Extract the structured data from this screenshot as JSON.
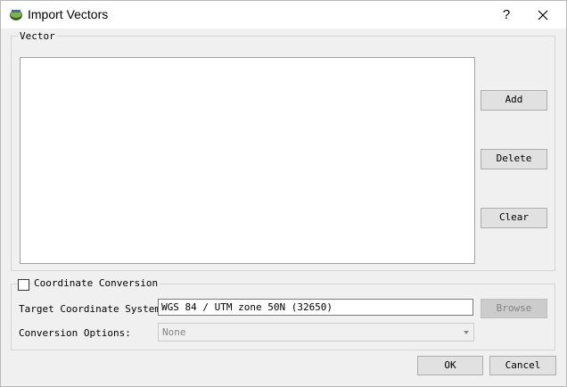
{
  "window": {
    "title": "Import Vectors",
    "help_label": "?"
  },
  "vector_group": {
    "legend": "Vector",
    "buttons": {
      "add": "Add",
      "delete": "Delete",
      "clear": "Clear"
    }
  },
  "conversion_group": {
    "checkbox_label": "Coordinate Conversion",
    "checked": false,
    "target_label": "Target Coordinate System:",
    "target_value": "WGS 84 / UTM zone 50N (32650)",
    "browse_label": "Browse",
    "options_label": "Conversion Options:",
    "options_value": "None"
  },
  "footer": {
    "ok_label": "OK",
    "cancel_label": "Cancel"
  },
  "colors": {
    "dialog_bg": "#f0f0f0",
    "button_bg": "#e1e1e1",
    "disabled_text": "#838383"
  }
}
